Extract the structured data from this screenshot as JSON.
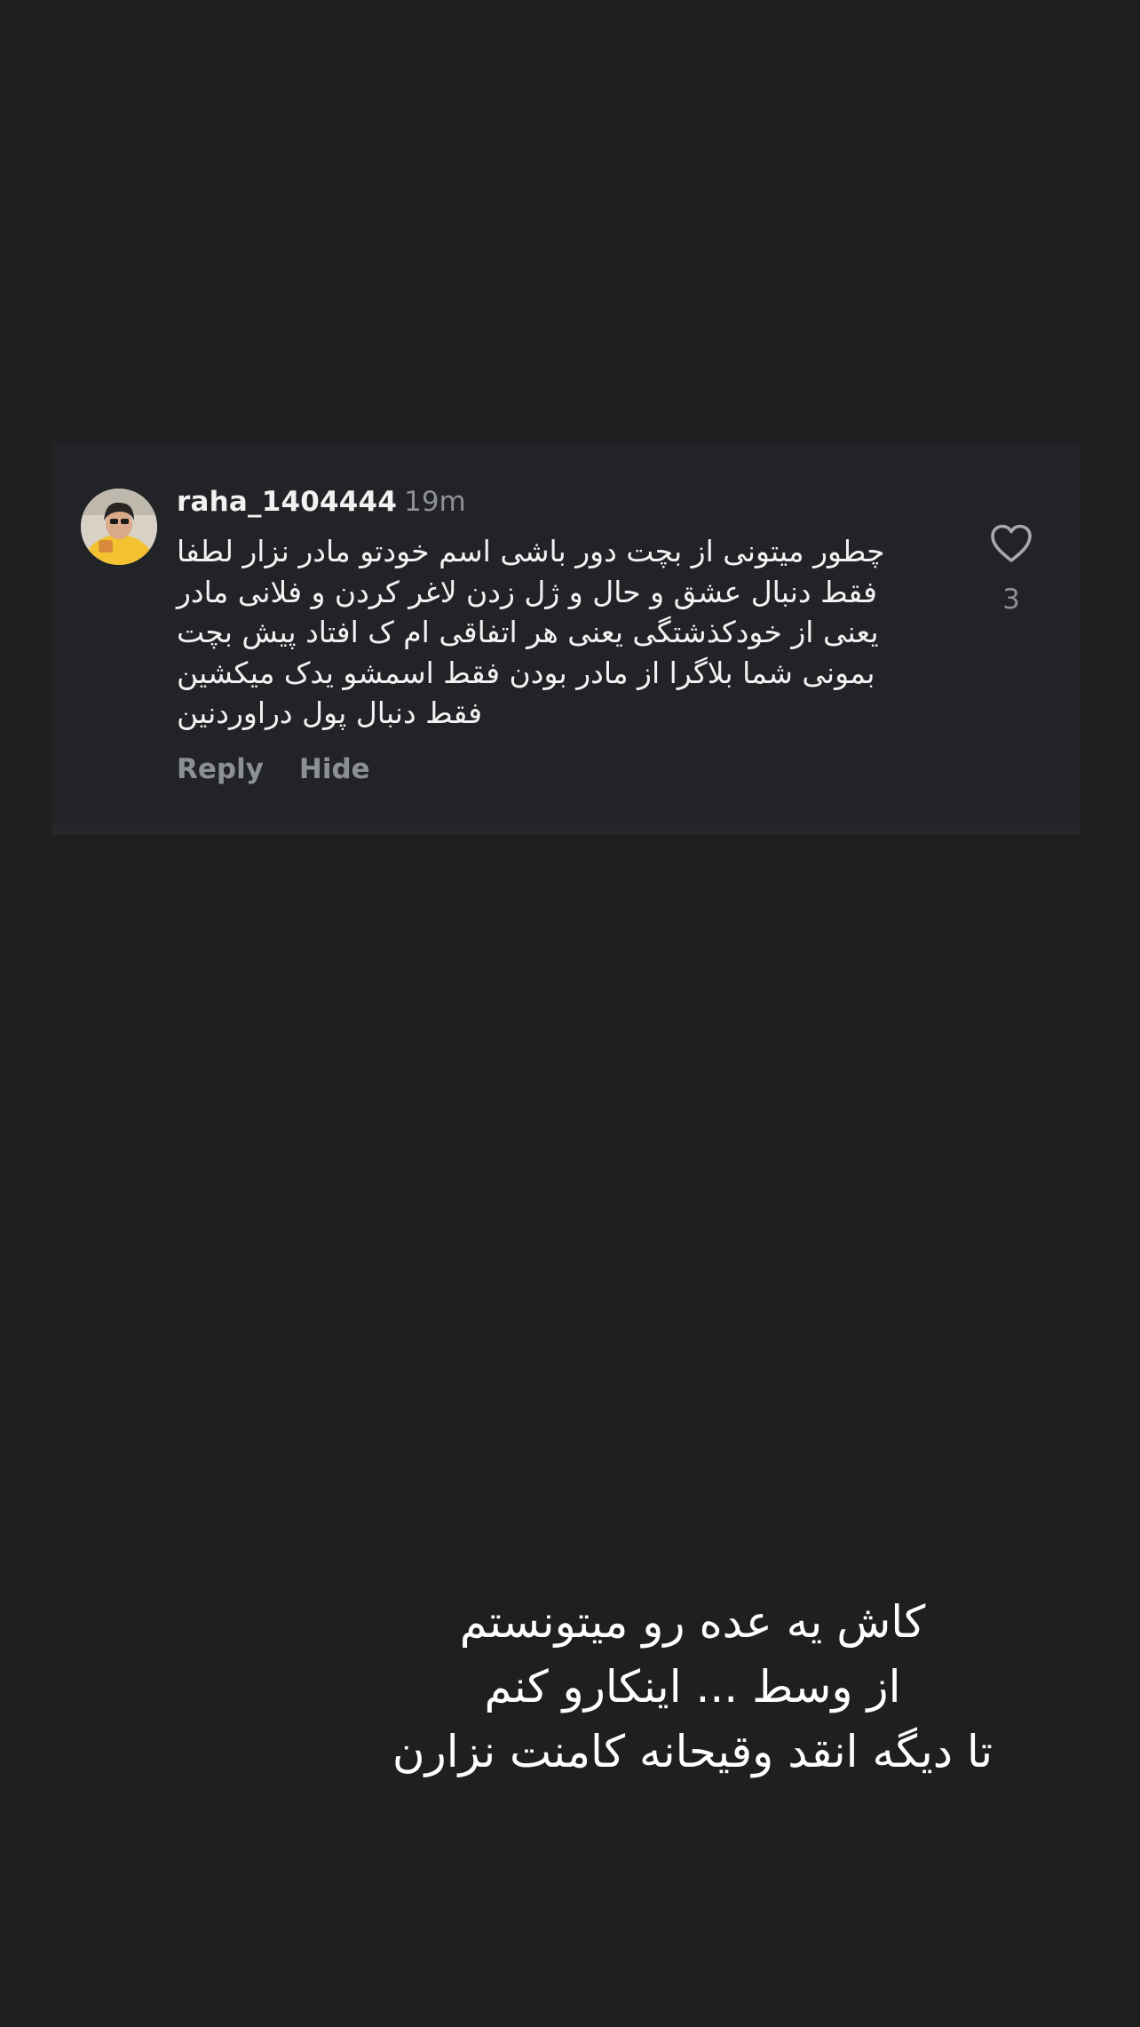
{
  "comment": {
    "username": "raha_1404444",
    "time": "19m",
    "text_lines": [
      "چطور میتونی از بچت دور باشی اسم خودتو مادر نزار لطفا",
      "فقط دنبال عشق و حال و ژل زدن لاغر کردن و فلانی مادر",
      "یعنی از خودکذشتگی یعنی هر اتفاقی ام ک افتاد پیش بچت",
      "بمونی شما بلاگرا از مادر بودن فقط اسمشو یدک میکشین",
      "فقط دنبال پول دراوردنین"
    ],
    "reply_label": "Reply",
    "hide_label": "Hide",
    "like_icon": "heart-outline-icon",
    "like_count": "3"
  },
  "story_caption": {
    "lines": [
      "کاش یه عده رو میتونستم",
      "از وسط ... اینکارو کنم",
      "تا دیگه انقد وقیحانه کامنت نزارن"
    ]
  },
  "colors": {
    "background": "#1f1f1f",
    "card": "#222327",
    "primary_text": "#f2f2f2",
    "secondary_text": "#8d8f96"
  }
}
